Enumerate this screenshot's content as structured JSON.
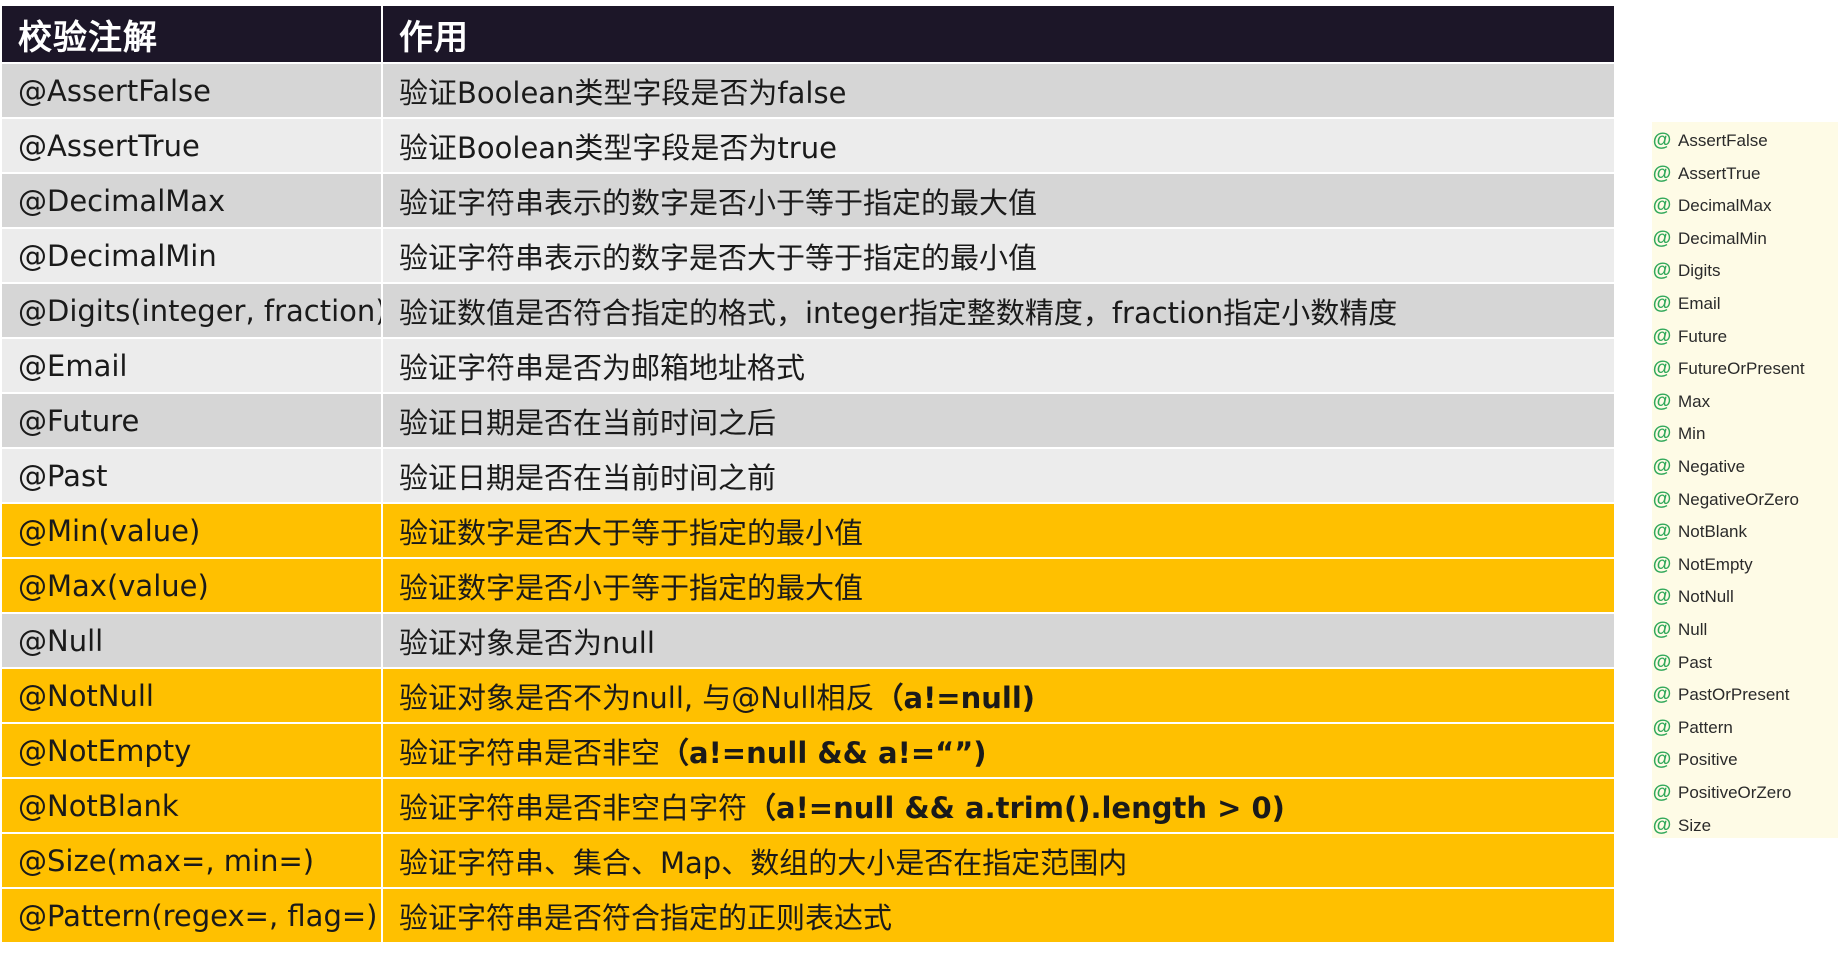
{
  "table": {
    "headers": [
      "校验注解",
      "作用"
    ],
    "rows": [
      {
        "annotation": "@AssertFalse",
        "desc": "验证Boolean类型字段是否为false",
        "desc_bold": "",
        "style": "dark"
      },
      {
        "annotation": "@AssertTrue",
        "desc": "验证Boolean类型字段是否为true",
        "desc_bold": "",
        "style": "light"
      },
      {
        "annotation": "@DecimalMax",
        "desc": "验证字符串表示的数字是否小于等于指定的最大值",
        "desc_bold": "",
        "style": "dark"
      },
      {
        "annotation": "@DecimalMin",
        "desc": "验证字符串表示的数字是否大于等于指定的最小值",
        "desc_bold": "",
        "style": "light"
      },
      {
        "annotation": "@Digits(integer, fraction)",
        "desc": "验证数值是否符合指定的格式，integer指定整数精度，fraction指定小数精度",
        "desc_bold": "",
        "style": "dark"
      },
      {
        "annotation": "@Email",
        "desc": "验证字符串是否为邮箱地址格式",
        "desc_bold": "",
        "style": "light"
      },
      {
        "annotation": "@Future",
        "desc": "验证日期是否在当前时间之后",
        "desc_bold": "",
        "style": "dark"
      },
      {
        "annotation": "@Past",
        "desc": "验证日期是否在当前时间之前",
        "desc_bold": "",
        "style": "light"
      },
      {
        "annotation": "@Min(value)",
        "desc": "验证数字是否大于等于指定的最小值",
        "desc_bold": "",
        "style": "highlight"
      },
      {
        "annotation": "@Max(value)",
        "desc": "验证数字是否小于等于指定的最大值",
        "desc_bold": "",
        "style": "highlight"
      },
      {
        "annotation": "@Null",
        "desc": "验证对象是否为null",
        "desc_bold": "",
        "style": "dark"
      },
      {
        "annotation": "@NotNull",
        "desc": "验证对象是否不为null, 与@Null相反",
        "desc_bold": "（a!=null)",
        "style": "highlight"
      },
      {
        "annotation": "@NotEmpty",
        "desc": "验证字符串是否非空",
        "desc_bold": "（a!=null  && a!=“”)",
        "style": "highlight"
      },
      {
        "annotation": "@NotBlank",
        "desc": "验证字符串是否非空白字符",
        "desc_bold": "（a!=null  && a.trim().length > 0)",
        "style": "highlight"
      },
      {
        "annotation": "@Size(max=, min=)",
        "desc": "验证字符串、集合、Map、数组的大小是否在指定范围内",
        "desc_bold": "",
        "style": "highlight"
      },
      {
        "annotation": "@Pattern(regex=, flag=)",
        "desc": "验证字符串是否符合指定的正则表达式",
        "desc_bold": "",
        "style": "highlight"
      }
    ]
  },
  "autocomplete": {
    "icon_glyph": "@",
    "icon_color": "#31a85a",
    "items": [
      "AssertFalse",
      "AssertTrue",
      "DecimalMax",
      "DecimalMin",
      "Digits",
      "Email",
      "Future",
      "FutureOrPresent",
      "Max",
      "Min",
      "Negative",
      "NegativeOrZero",
      "NotBlank",
      "NotEmpty",
      "NotNull",
      "Null",
      "Past",
      "PastOrPresent",
      "Pattern",
      "Positive",
      "PositiveOrZero",
      "Size"
    ]
  },
  "colors": {
    "header_bg": "#1c1628",
    "row_dark": "#d6d6d6",
    "row_light": "#ececec",
    "row_highlight": "#ffc000",
    "panel_bg": "#fefbe6"
  }
}
